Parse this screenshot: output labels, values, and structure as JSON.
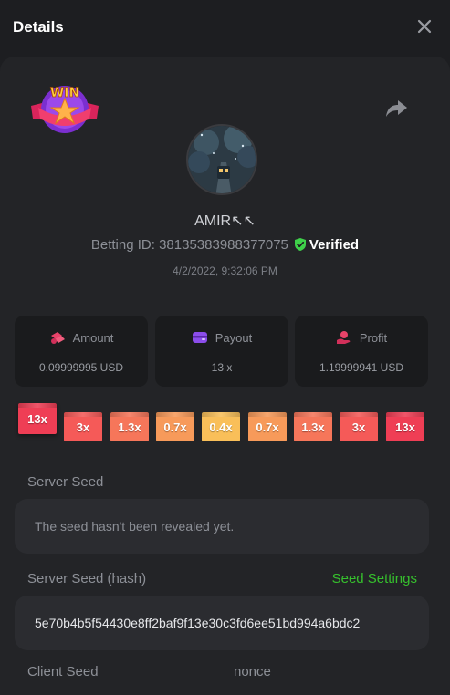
{
  "header": {
    "title": "Details"
  },
  "player": {
    "username": "AMIR↖↖",
    "betting_id": "Betting ID: 38135383988377075",
    "verified_label": "Verified",
    "datetime": "4/2/2022, 9:32:06 PM"
  },
  "badge": {
    "text": "WIN"
  },
  "stats": {
    "amount_label": "Amount",
    "amount_value": "0.09999995 USD",
    "payout_label": "Payout",
    "payout_value": "13 x",
    "profit_label": "Profit",
    "profit_value": "1.19999941 USD"
  },
  "multipliers": [
    {
      "label": "13x",
      "color": "#ef3e55",
      "hit": true
    },
    {
      "label": "3x",
      "color": "#f55a58"
    },
    {
      "label": "1.3x",
      "color": "#f6765a"
    },
    {
      "label": "0.7x",
      "color": "#f79a5a"
    },
    {
      "label": "0.4x",
      "color": "#f9bf59"
    },
    {
      "label": "0.7x",
      "color": "#f79a5a"
    },
    {
      "label": "1.3x",
      "color": "#f6765a"
    },
    {
      "label": "3x",
      "color": "#f55a58"
    },
    {
      "label": "13x",
      "color": "#ef3e55"
    }
  ],
  "seeds": {
    "server_seed_label": "Server Seed",
    "server_seed_value": "The seed hasn't been revealed yet.",
    "server_seed_hash_label": "Server Seed (hash)",
    "seed_settings_label": "Seed Settings",
    "server_seed_hash_value": "5e70b4b5f54430e8ff2baf9f13e30c3fd6ee51bd994a6bdc2",
    "client_seed_label": "Client Seed",
    "nonce_label": "nonce"
  },
  "colors": {
    "accent_green": "#36c02d",
    "verified_green": "#3fd14a",
    "panel": "#232427",
    "card": "#1a1b1d"
  }
}
